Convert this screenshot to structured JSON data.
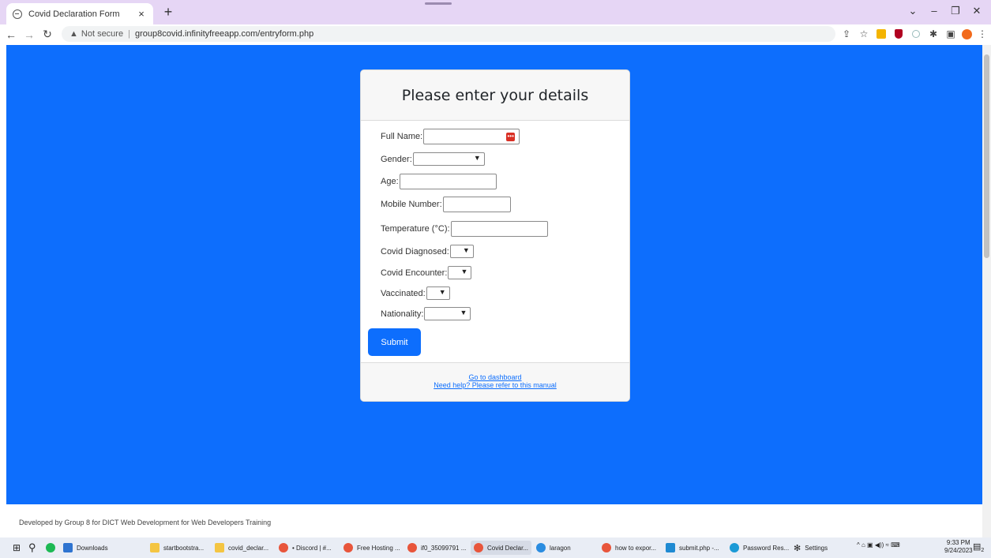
{
  "browser": {
    "tab_title": "Covid Declaration Form",
    "tab_close": "×",
    "new_tab": "+",
    "window_controls": [
      "⌄",
      "–",
      "❐",
      "✕"
    ],
    "security": "Not secure",
    "url": "group8covid.infinityfreeapp.com/entryform.php"
  },
  "form": {
    "header": "Please enter your details",
    "fields": {
      "full_name": "Full Name:",
      "gender": "Gender:",
      "age": "Age:",
      "mobile": "Mobile Number:",
      "temperature": "Temperature (°C):",
      "covid_diagnosed": "Covid Diagnosed:",
      "covid_encounter": "Covid Encounter:",
      "vaccinated": "Vaccinated:",
      "nationality": "Nationality:"
    },
    "submit_label": "Submit",
    "links": {
      "dashboard": "Go to dashboard",
      "manual": "Need help? Please refer to this manual"
    }
  },
  "footer": {
    "text": "Developed by Group 8 for DICT Web Development for Web Developers Training"
  },
  "taskbar": {
    "items": [
      "Downloads",
      "startbootstra...",
      "covid_declar...",
      "• Discord | #...",
      "Free Hosting ...",
      "if0_35099791 ...",
      "Covid Declar...",
      "laragon",
      "how to expor...",
      "submit.php -...",
      "Password Res...",
      "Settings"
    ],
    "time": "9:33 PM",
    "date": "9/24/2023",
    "notification_count": "2"
  },
  "colors": {
    "page_background": "#0d6efd",
    "tabbar": "#e6d6f5",
    "button": "#0d6efd"
  }
}
